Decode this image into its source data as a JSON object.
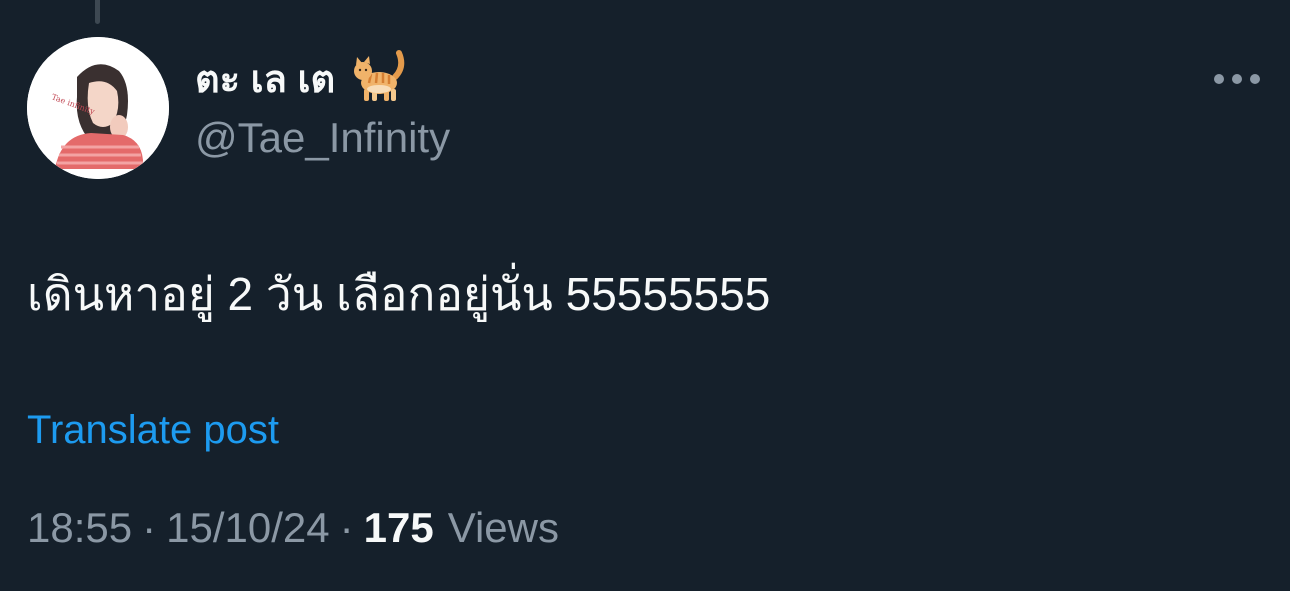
{
  "author": {
    "display_name": "ตะ เล เต",
    "name_emoji": "cat-icon",
    "handle": "@Tae_Infinity",
    "avatar_signature": "Tae infinity"
  },
  "post": {
    "text": "เดินหาอยู่ 2 วัน เลือกอยู่นั่น 55555555",
    "translate_label": "Translate post"
  },
  "meta": {
    "time": "18:55",
    "separator": "·",
    "date": "15/10/24",
    "views_count": "175",
    "views_label": "Views"
  },
  "colors": {
    "background": "#15202b",
    "text_primary": "#f7f9f9",
    "text_secondary": "#8b98a5",
    "link": "#1d9bf0"
  }
}
